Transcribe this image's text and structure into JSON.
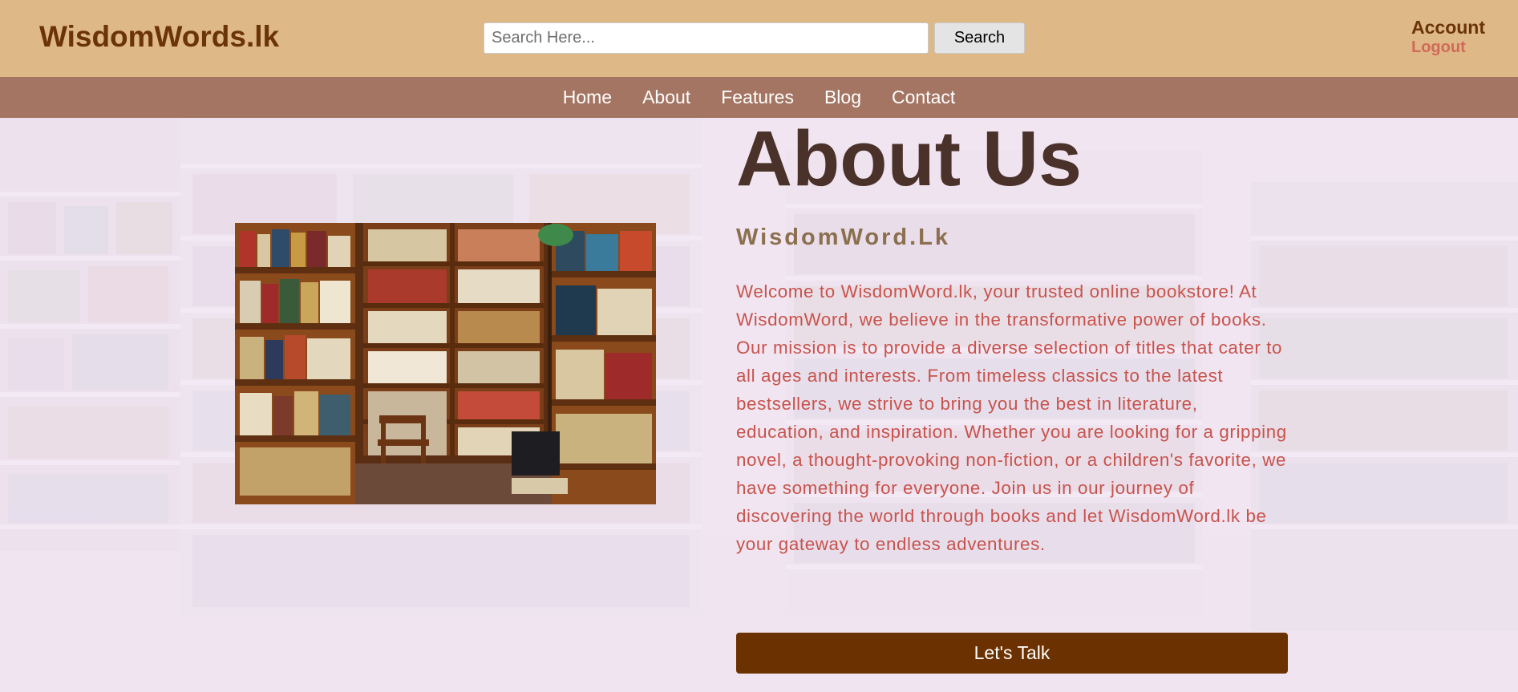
{
  "header": {
    "logo": "WisdomWords.lk",
    "search": {
      "placeholder": "Search Here...",
      "value": "",
      "button_label": "Search"
    },
    "account": {
      "label": "Account",
      "logout_label": "Logout"
    }
  },
  "nav": {
    "items": [
      {
        "label": "Home"
      },
      {
        "label": "About"
      },
      {
        "label": "Features"
      },
      {
        "label": "Blog"
      },
      {
        "label": "Contact"
      }
    ]
  },
  "about": {
    "title": "About Us",
    "subtitle": "WisdomWord.Lk",
    "paragraph": "Welcome to WisdomWord.lk, your trusted online bookstore! At WisdomWord, we believe in the transformative power of books. Our mission is to provide a diverse selection of titles that cater to all ages and interests. From timeless classics to the latest bestsellers, we strive to bring you the best in literature, education, and inspiration. Whether you are looking for a gripping novel, a thought-provoking non-fiction, or a children's favorite, we have something for everyone. Join us in our journey of discovering the world through books and let WisdomWord.lk be your gateway to endless adventures.",
    "cta_label": "Let's Talk"
  },
  "colors": {
    "header_bg": "#deb887",
    "nav_bg": "#a47562",
    "logo": "#6b3309",
    "logout": "#d16a58",
    "title": "#4a3129",
    "subtitle": "#8b6f4e",
    "body_text": "#c8534d",
    "cta_bg": "#6b3100"
  },
  "icons": {
    "background": "library-shelves-background",
    "photo": "bookstore-shelves-photo"
  }
}
